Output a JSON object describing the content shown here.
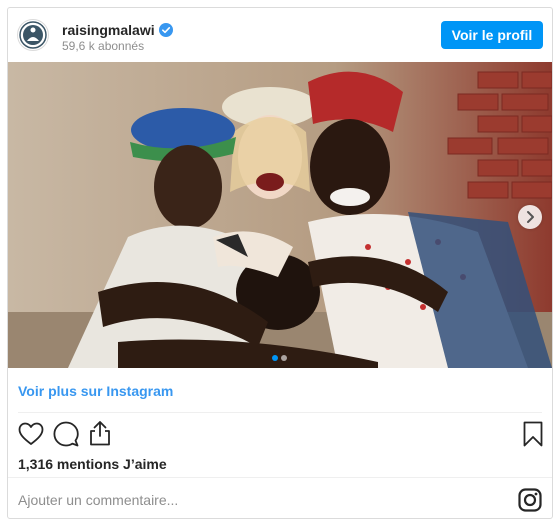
{
  "header": {
    "username": "raisingmalawi",
    "verified": true,
    "followers": "59,6 k abonnés",
    "follow_label": "Voir le profil",
    "accent_color": "#0095f6"
  },
  "post": {
    "carousel": {
      "total": 2,
      "current": 1
    },
    "view_more_label": "Voir plus sur Instagram",
    "likes": "1,316 mentions J’aime",
    "comment_placeholder": "Ajouter un commentaire..."
  },
  "icons": [
    "verified-icon",
    "chevron-right-icon",
    "heart-icon",
    "comment-icon",
    "share-icon",
    "bookmark-icon",
    "instagram-icon"
  ]
}
